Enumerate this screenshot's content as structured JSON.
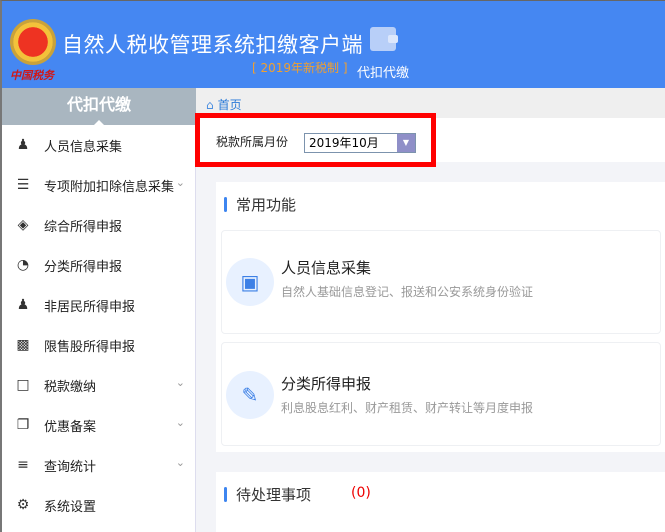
{
  "header": {
    "logo_text": "中国税务",
    "title": "自然人税收管理系统扣缴客户端",
    "badge": "[ 2019年新税制 ]",
    "mode_label": "代扣代缴",
    "mode_icon": "wallet-icon"
  },
  "sidebar": {
    "title": "代扣代缴",
    "items": [
      {
        "label": "人员信息采集",
        "icon": "user-add-icon",
        "expandable": false
      },
      {
        "label": "专项附加扣除信息采集",
        "icon": "list-icon",
        "expandable": true
      },
      {
        "label": "综合所得申报",
        "icon": "layers-icon",
        "expandable": false
      },
      {
        "label": "分类所得申报",
        "icon": "pie-chart-icon",
        "expandable": false
      },
      {
        "label": "非居民所得申报",
        "icon": "user-list-icon",
        "expandable": false
      },
      {
        "label": "限售股所得申报",
        "icon": "bar-chart-icon",
        "expandable": false
      },
      {
        "label": "税款缴纳",
        "icon": "folder-icon",
        "expandable": true
      },
      {
        "label": "优惠备案",
        "icon": "copy-icon",
        "expandable": true
      },
      {
        "label": "查询统计",
        "icon": "search-list-icon",
        "expandable": true
      },
      {
        "label": "系统设置",
        "icon": "gear-icon",
        "expandable": false
      }
    ]
  },
  "breadcrumb": {
    "home": "首页"
  },
  "filter": {
    "label": "税款所属月份",
    "value": "2019年10月"
  },
  "common": {
    "title": "常用功能",
    "cards": [
      {
        "title": "人员信息采集",
        "desc": "自然人基础信息登记、报送和公安系统身份验证",
        "icon": "id-card-icon"
      },
      {
        "title": "分类所得申报",
        "desc": "利息股息红利、财产租赁、财产转让等月度申报",
        "icon": "edit-icon"
      }
    ]
  },
  "pending": {
    "title": "待处理事项",
    "count": "(0)"
  },
  "colors": {
    "header": "#4587f2",
    "accent": "#3d85f0",
    "highlight_box": "#ff0000",
    "count": "#ee0000"
  }
}
